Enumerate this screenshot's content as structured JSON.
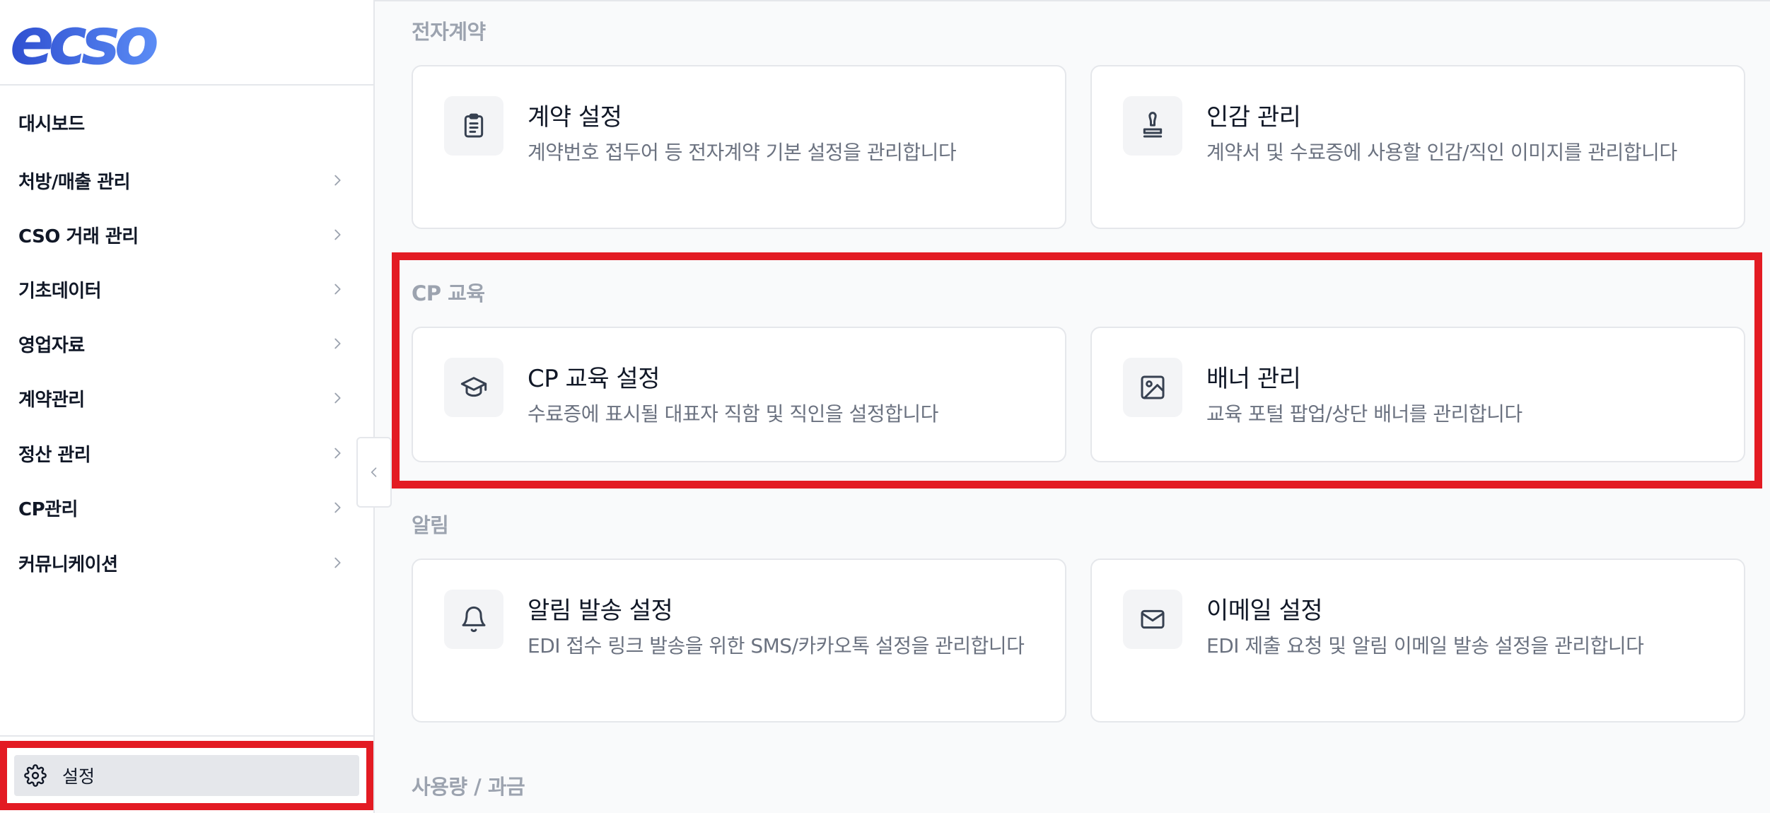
{
  "brand": {
    "logo_text": "ecso",
    "logo_color": "#3b5bdb"
  },
  "sidebar": {
    "items": [
      {
        "label": "대시보드",
        "has_children": false
      },
      {
        "label": "처방/매출 관리",
        "has_children": true
      },
      {
        "label": "CSO 거래 관리",
        "has_children": true
      },
      {
        "label": "기초데이터",
        "has_children": true
      },
      {
        "label": "영업자료",
        "has_children": true
      },
      {
        "label": "계약관리",
        "has_children": true
      },
      {
        "label": "정산 관리",
        "has_children": true
      },
      {
        "label": "CP관리",
        "has_children": true
      },
      {
        "label": "커뮤니케이션",
        "has_children": true
      }
    ],
    "settings": {
      "label": "설정",
      "icon": "gear-icon",
      "active": true
    },
    "collapse_icon": "chevron-left-icon"
  },
  "main": {
    "sections": [
      {
        "title": "전자계약",
        "cards": [
          {
            "title": "계약 설정",
            "desc": "계약번호 접두어 등 전자계약 기본 설정을 관리합니다",
            "icon": "clipboard-list-icon"
          },
          {
            "title": "인감 관리",
            "desc": "계약서 및 수료증에 사용할 인감/직인 이미지를 관리합니다",
            "icon": "stamp-icon"
          }
        ]
      },
      {
        "title": "CP 교육",
        "cards": [
          {
            "title": "CP 교육 설정",
            "desc": "수료증에 표시될 대표자 직함 및 직인을 설정합니다",
            "icon": "graduation-cap-icon"
          },
          {
            "title": "배너 관리",
            "desc": "교육 포털 팝업/상단 배너를 관리합니다",
            "icon": "image-icon"
          }
        ]
      },
      {
        "title": "알림",
        "cards": [
          {
            "title": "알림 발송 설정",
            "desc": "EDI 접수 링크 발송을 위한 SMS/카카오톡 설정을 관리합니다",
            "icon": "bell-icon"
          },
          {
            "title": "이메일 설정",
            "desc": "EDI 제출 요청 및 알림 이메일 발송 설정을 관리합니다",
            "icon": "mail-icon"
          }
        ]
      },
      {
        "title": "사용량 / 과금",
        "cards": []
      }
    ]
  },
  "colors": {
    "highlight": "#e31b23",
    "muted_text": "#6b7280",
    "section_title": "#9ca3af"
  }
}
